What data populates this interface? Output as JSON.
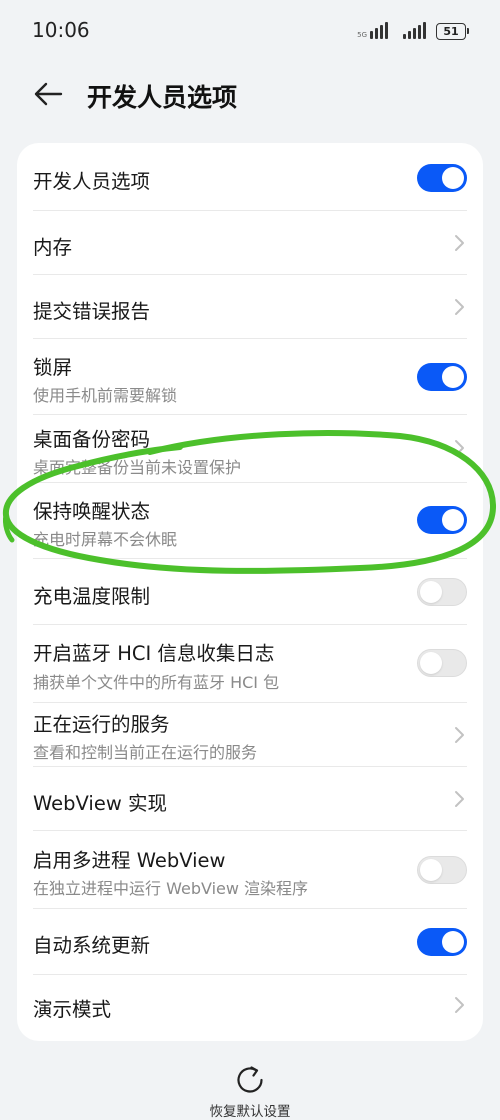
{
  "status_bar": {
    "time": "10:06",
    "signal_badge": "5G",
    "battery": "51"
  },
  "header": {
    "title": "开发人员选项",
    "back_icon": "arrow-left-icon"
  },
  "settings": {
    "items": [
      {
        "title": "开发人员选项",
        "control": "toggle",
        "state": "on"
      },
      {
        "title": "内存",
        "control": "chevron"
      },
      {
        "title": "提交错误报告",
        "control": "chevron"
      },
      {
        "title": "锁屏",
        "subtitle": "使用手机前需要解锁",
        "control": "toggle",
        "state": "on"
      },
      {
        "title": "桌面备份密码",
        "subtitle": "桌面完整备份当前未设置保护",
        "control": "chevron"
      },
      {
        "title": "保持唤醒状态",
        "subtitle": "充电时屏幕不会休眠",
        "control": "toggle",
        "state": "on"
      },
      {
        "title": "充电温度限制",
        "control": "toggle",
        "state": "off"
      },
      {
        "title": "开启蓝牙 HCI 信息收集日志",
        "subtitle": "捕获单个文件中的所有蓝牙 HCI 包",
        "control": "toggle",
        "state": "off"
      },
      {
        "title": "正在运行的服务",
        "subtitle": "查看和控制当前正在运行的服务",
        "control": "chevron"
      },
      {
        "title": "WebView 实现",
        "control": "chevron"
      },
      {
        "title": "启用多进程 WebView",
        "subtitle": "在独立进程中运行 WebView 渲染程序",
        "control": "toggle",
        "state": "off"
      },
      {
        "title": "自动系统更新",
        "control": "toggle",
        "state": "on"
      },
      {
        "title": "演示模式",
        "control": "chevron"
      }
    ]
  },
  "footer": {
    "reset_label": "恢复默认设置",
    "reset_icon": "refresh-icon"
  },
  "colors": {
    "accent": "#0a59f7",
    "annotation": "#4cc02b",
    "background": "#f1f3f5"
  }
}
